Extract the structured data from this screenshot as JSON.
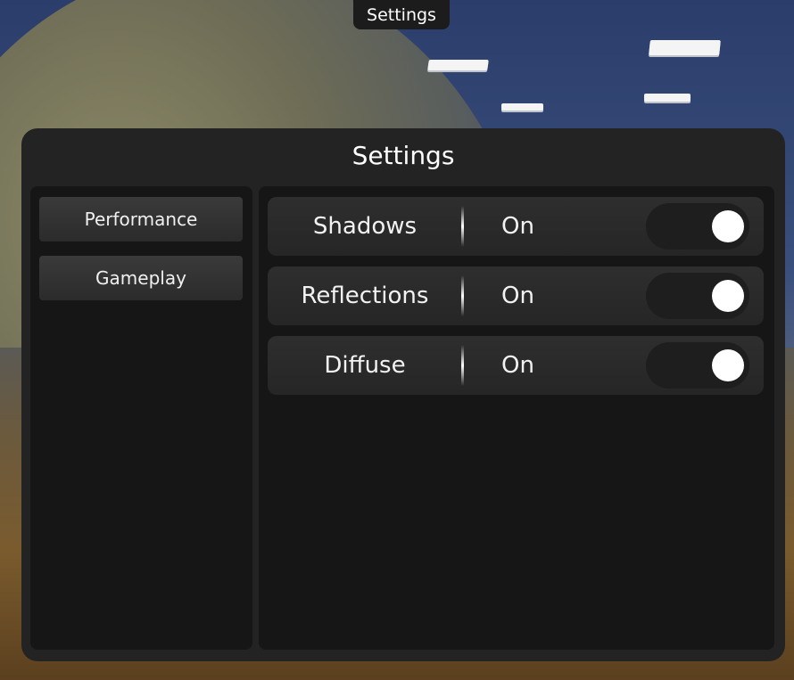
{
  "top_tab": {
    "label": "Settings"
  },
  "panel": {
    "title": "Settings"
  },
  "sidebar": {
    "items": [
      {
        "label": "Performance"
      },
      {
        "label": "Gameplay"
      }
    ]
  },
  "settings": [
    {
      "name": "Shadows",
      "value": "On",
      "enabled": true
    },
    {
      "name": "Reflections",
      "value": "On",
      "enabled": true
    },
    {
      "name": "Diffuse",
      "value": "On",
      "enabled": true
    }
  ],
  "colors": {
    "panel_bg": "#232323",
    "inner_bg": "#161616",
    "toggle_knob": "#ffffff"
  }
}
